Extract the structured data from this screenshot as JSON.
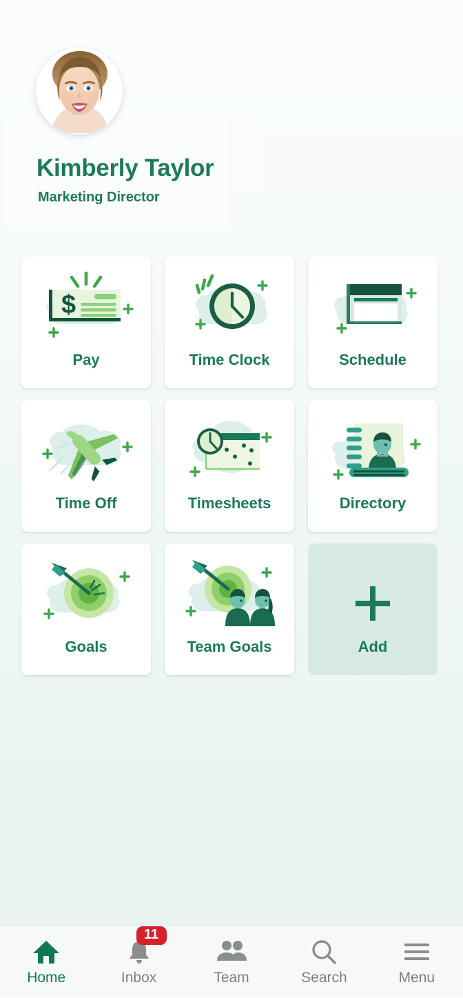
{
  "theme": {
    "accent_green": "#1b7a5a",
    "dark_green": "#14533d",
    "mid_green": "#2f9e63",
    "light_green": "#8cd07a",
    "pale_green": "#e8f4e0",
    "blob_mint": "#dcefea",
    "add_tile_bg": "#d8e9e4",
    "badge_red": "#d6202b",
    "nav_inactive": "#7b7f7e",
    "nav_active": "#0f7a52",
    "page_bg_top": "#fafcfb",
    "page_bg_bottom": "#e9f4f1"
  },
  "profile": {
    "name": "Kimberly Taylor",
    "role": "Marketing Director",
    "avatar_icon": "user-photo-avatar"
  },
  "grid": {
    "tiles": [
      {
        "label": "Pay",
        "icon": "paycheck-icon",
        "type": "app"
      },
      {
        "label": "Time Clock",
        "icon": "clock-icon",
        "type": "app"
      },
      {
        "label": "Schedule",
        "icon": "calendar-icon",
        "type": "app"
      },
      {
        "label": "Time Off",
        "icon": "airplane-icon",
        "type": "app"
      },
      {
        "label": "Timesheets",
        "icon": "timesheet-icon",
        "type": "app"
      },
      {
        "label": "Directory",
        "icon": "address-book-icon",
        "type": "app"
      },
      {
        "label": "Goals",
        "icon": "target-arrow-icon",
        "type": "app"
      },
      {
        "label": "Team Goals",
        "icon": "team-target-icon",
        "type": "app"
      },
      {
        "label": "Add",
        "icon": "plus-icon",
        "type": "add"
      }
    ]
  },
  "bottom_nav": {
    "items": [
      {
        "label": "Home",
        "icon": "home-icon",
        "active": true,
        "badge": null
      },
      {
        "label": "Inbox",
        "icon": "bell-icon",
        "active": false,
        "badge": "11"
      },
      {
        "label": "Team",
        "icon": "people-icon",
        "active": false,
        "badge": null
      },
      {
        "label": "Search",
        "icon": "search-icon",
        "active": false,
        "badge": null
      },
      {
        "label": "Menu",
        "icon": "hamburger-menu-icon",
        "active": false,
        "badge": null
      }
    ]
  }
}
